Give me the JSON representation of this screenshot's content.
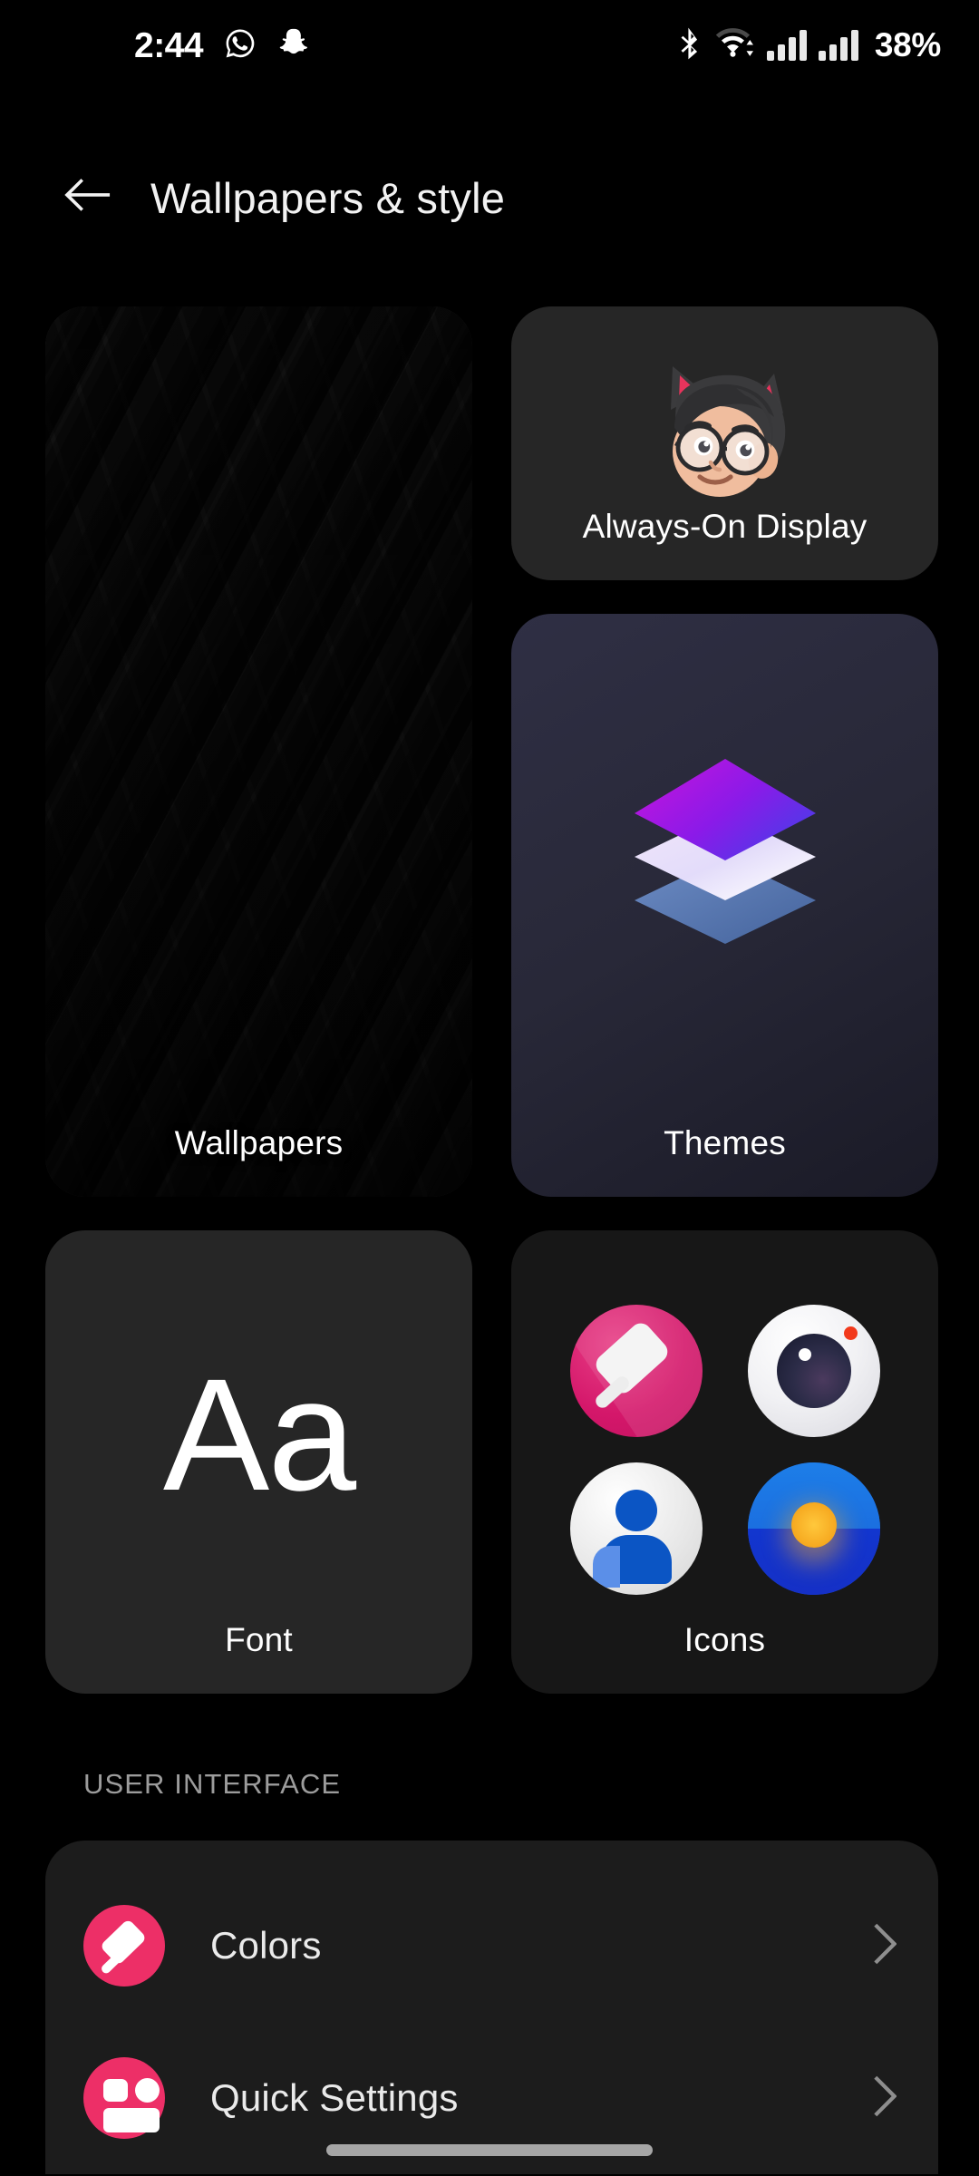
{
  "status_bar": {
    "time": "2:44",
    "battery_percent": "38%",
    "left_icons": [
      "whatsapp-icon",
      "snapchat-icon"
    ],
    "right_icons": [
      "bluetooth-icon",
      "wifi-icon",
      "signal-sim1-icon",
      "signal-sim2-icon"
    ]
  },
  "header": {
    "title": "Wallpapers & style",
    "back_icon": "arrow-left-icon"
  },
  "cards": [
    {
      "id": "wallpapers",
      "label": "Wallpapers",
      "art": "wallpaper-preview-dark-chevron-pattern"
    },
    {
      "id": "always_on_display",
      "label": "Always-On Display",
      "art": "avatar-emoji-cat-ears-glasses"
    },
    {
      "id": "themes",
      "label": "Themes",
      "art": "stacked-layers-icon"
    },
    {
      "id": "font",
      "label": "Font",
      "art": "Aa"
    },
    {
      "id": "icons",
      "label": "Icons",
      "art": "app-icon-grid"
    }
  ],
  "icons_preview": [
    {
      "name": "themes-app-icon",
      "glyph": "paint-roller-icon",
      "color": "#d4176a"
    },
    {
      "name": "camera-app-icon",
      "glyph": "camera-lens-icon",
      "color": "#ffffff"
    },
    {
      "name": "contacts-app-icon",
      "glyph": "person-icon",
      "color": "#e7e7e7"
    },
    {
      "name": "gallery-app-icon",
      "glyph": "sunset-icon",
      "color": "#1850d8"
    }
  ],
  "section": {
    "title": "USER INTERFACE",
    "items": [
      {
        "label": "Colors",
        "icon": "paint-roller-icon",
        "icon_color": "#ed2f67",
        "chevron": "chevron-right-icon"
      },
      {
        "label": "Quick Settings",
        "icon": "quick-settings-tiles-icon",
        "icon_color": "#ed2f67",
        "chevron": "chevron-right-icon"
      }
    ]
  },
  "colors": {
    "background": "#000000",
    "card": "#262626",
    "list_card": "#1c1c1c",
    "accent_pink": "#ed2f67",
    "text_primary": "#ffffff",
    "text_secondary": "#9c9c9c"
  },
  "nav": {
    "gesture_bar": true
  }
}
